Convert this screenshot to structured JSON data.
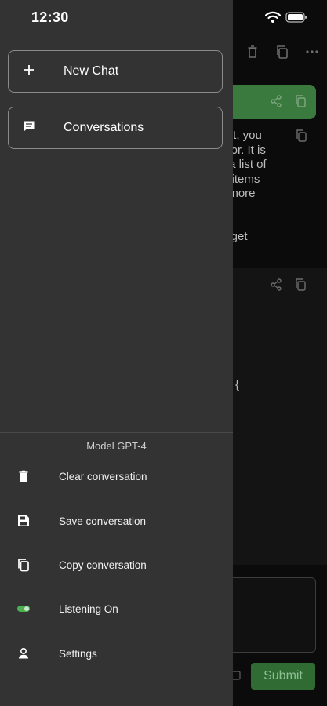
{
  "status_bar": {
    "time": "12:30"
  },
  "drawer": {
    "buttons": [
      {
        "label": "New Chat",
        "icon": "plus-icon"
      },
      {
        "label": "Conversations",
        "icon": "chat-bubble-icon"
      }
    ],
    "model_label": "Model GPT-4",
    "menu": [
      {
        "label": "Clear conversation",
        "icon": "trash-icon"
      },
      {
        "label": "Save conversation",
        "icon": "save-icon"
      },
      {
        "label": "Copy conversation",
        "icon": "copy-icon"
      },
      {
        "label": "Listening On",
        "icon": "toggle-on-icon"
      },
      {
        "label": "Settings",
        "icon": "person-icon"
      }
    ]
  },
  "background_chat": {
    "message_text": "list, you\nctor. It is\nr a list of\ne items\nt more",
    "message_text_2": "idget",
    "code_brace": "{",
    "submit_label": "Submit",
    "accent_color": "#3a7a3e"
  }
}
